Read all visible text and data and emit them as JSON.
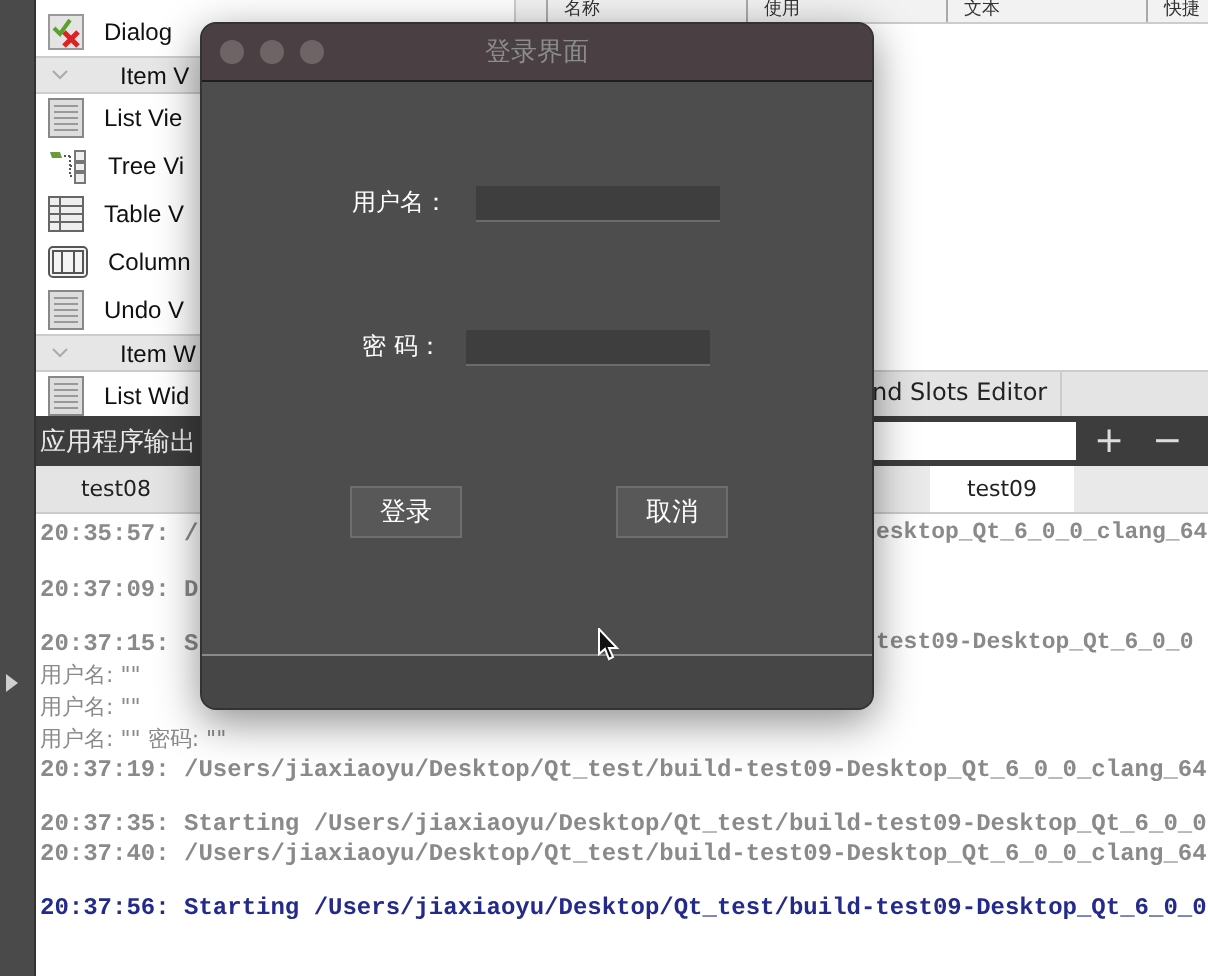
{
  "widget_box": {
    "items": [
      {
        "kind": "widget",
        "label": "Dialog"
      },
      {
        "kind": "header",
        "label": "Item V"
      },
      {
        "kind": "widget",
        "label": "List Vie"
      },
      {
        "kind": "widget",
        "label": "Tree Vi"
      },
      {
        "kind": "widget",
        "label": "Table V"
      },
      {
        "kind": "widget",
        "label": "Column"
      },
      {
        "kind": "widget",
        "label": "Undo V"
      },
      {
        "kind": "header",
        "label": "Item W"
      },
      {
        "kind": "widget",
        "label": "List Wid"
      }
    ]
  },
  "action_table": {
    "columns": [
      "名称",
      "使用",
      "文本",
      "快捷"
    ]
  },
  "editor_tabs": [
    {
      "label": "nd Slots Editor"
    }
  ],
  "output_pane": {
    "title": "应用程序输出",
    "buttons": [
      "+",
      "−"
    ],
    "tabs": [
      {
        "label": "test08",
        "selected": false
      },
      {
        "label": "test09",
        "selected": true
      }
    ],
    "blocks": [
      [
        {
          "kind": "message",
          "left": "20:35:57: /",
          "right": "esktop_Qt_6_0_0_clang_64"
        }
      ],
      [
        {
          "kind": "message",
          "left": "20:37:09: D"
        }
      ],
      [
        {
          "kind": "message",
          "left": "20:37:15: S",
          "right": "test09-Desktop_Qt_6_0_0"
        },
        {
          "kind": "app",
          "left": "用户名:  \"\""
        },
        {
          "kind": "app",
          "left": "用户名:  \"\""
        },
        {
          "kind": "app",
          "left": "用户名:  \"\"  密码:  \"\""
        },
        {
          "kind": "message",
          "left": "20:37:19: /Users/jiaxiaoyu/Desktop/Qt_test/build-test09-Desktop_Qt_6_0_0_clang_64"
        }
      ],
      [
        {
          "kind": "message",
          "left": "20:37:35: Starting /Users/jiaxiaoyu/Desktop/Qt_test/build-test09-Desktop_Qt_6_0_0"
        },
        {
          "kind": "message",
          "left": "20:37:40: /Users/jiaxiaoyu/Desktop/Qt_test/build-test09-Desktop_Qt_6_0_0_clang_64"
        }
      ],
      [
        {
          "kind": "start",
          "left": "20:37:56: Starting /Users/jiaxiaoyu/Desktop/Qt_test/build-test09-Desktop_Qt_6_0_0"
        }
      ]
    ]
  },
  "dialog": {
    "title": "登录界面",
    "fields": [
      {
        "label": "用户名："
      },
      {
        "label": "密 码："
      }
    ],
    "buttons": [
      "登录",
      "取消"
    ]
  }
}
